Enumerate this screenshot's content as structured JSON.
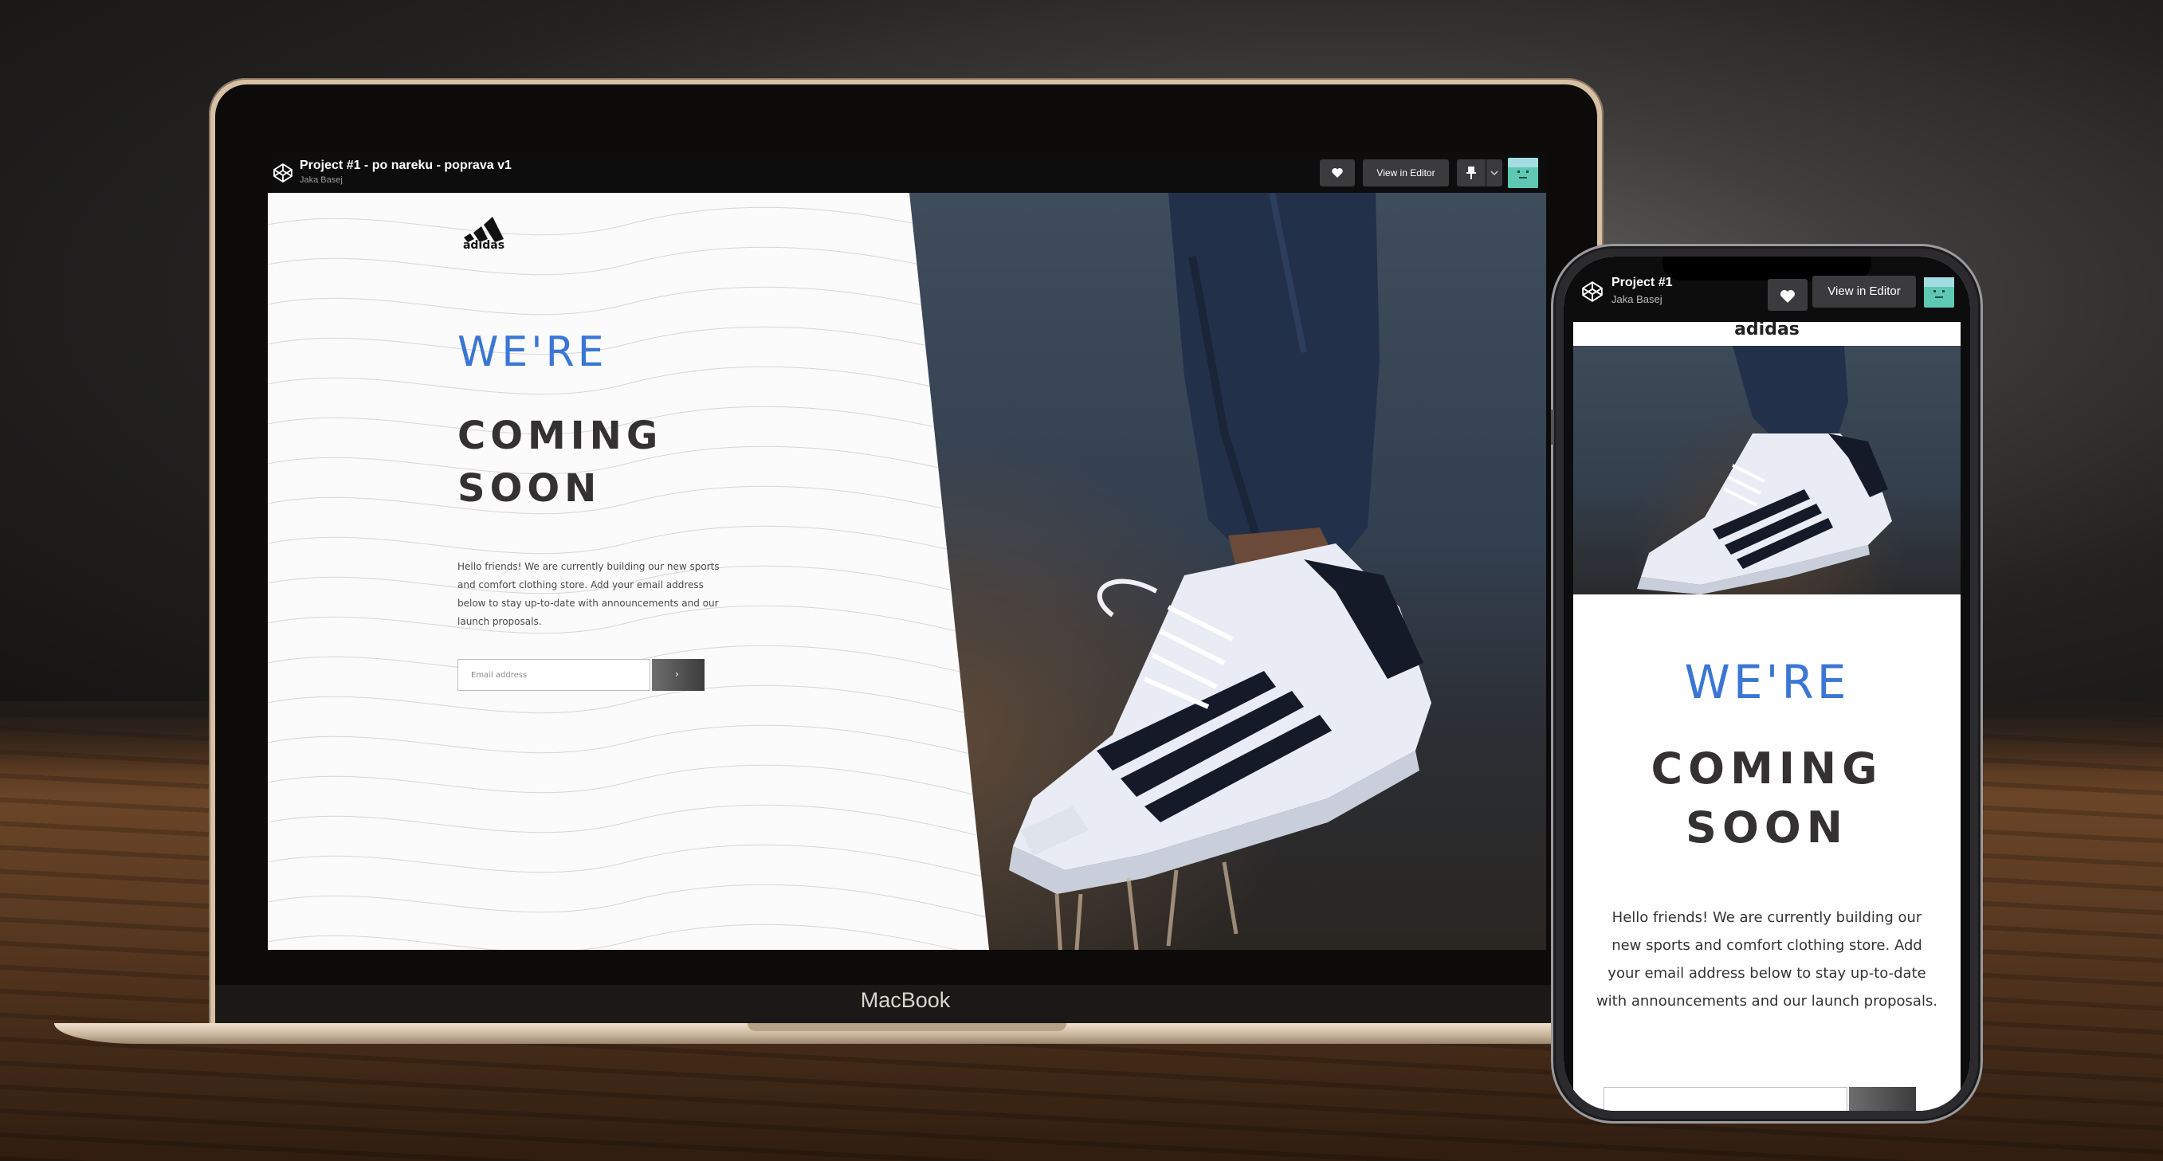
{
  "laptop": {
    "brand_label": "MacBook",
    "header": {
      "project_title": "Project #1 - po nareku - poprava v1",
      "author": "Jaka Basej",
      "view_in_editor": "View in Editor"
    },
    "site": {
      "logo_text": "adidas",
      "headline_top": "WE'RE",
      "headline_main_line1": "COMING",
      "headline_main_line2": "SOON",
      "description": "Hello friends! We are currently building our new sports and comfort clothing store. Add your email address below to stay up-to-date with announcements and our launch proposals.",
      "email_placeholder": "Email address",
      "submit_glyph": "›"
    }
  },
  "phone": {
    "header": {
      "project_title": "Project #1",
      "author": "Jaka Basej",
      "view_in_editor": "View in Editor"
    },
    "site": {
      "logo_text": "adidas",
      "headline_top": "WE'RE",
      "headline_main_line1": "COMING",
      "headline_main_line2": "SOON",
      "description": "Hello friends! We are currently building our new sports and comfort clothing store. Add your email address below to stay up-to-date with announcements and our launch proposals."
    }
  },
  "colors": {
    "accent_blue": "#3a76d4",
    "headline_dark": "#333132",
    "toolbar_button": "#3b3b3d",
    "avatar_teal": "#5fc8b3"
  }
}
